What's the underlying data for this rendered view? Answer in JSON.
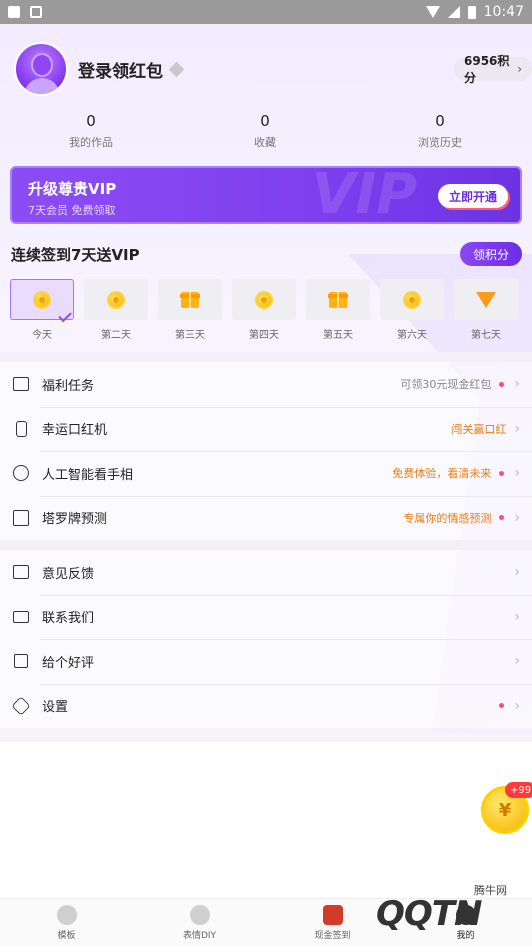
{
  "status_bar": {
    "time": "10:47"
  },
  "profile": {
    "login_text": "登录领红包",
    "points": "6956积分",
    "chevron": "›"
  },
  "stats": [
    {
      "value": "0",
      "label": "我的作品"
    },
    {
      "value": "0",
      "label": "收藏"
    },
    {
      "value": "0",
      "label": "浏览历史"
    }
  ],
  "vip": {
    "title": "升级尊贵VIP",
    "subtitle": "7天会员 免费领取",
    "button": "立即开通",
    "deco": "VIP"
  },
  "signin": {
    "title": "连续签到7天送VIP",
    "claim_button": "领积分",
    "days": [
      {
        "label": "今天",
        "icon": "coin-icon"
      },
      {
        "label": "第二天",
        "icon": "coin-icon"
      },
      {
        "label": "第三天",
        "icon": "gift-icon"
      },
      {
        "label": "第四天",
        "icon": "coin-icon"
      },
      {
        "label": "第五天",
        "icon": "gift-icon"
      },
      {
        "label": "第六天",
        "icon": "coin-icon"
      },
      {
        "label": "第七天",
        "icon": "gem-icon"
      }
    ]
  },
  "menu": {
    "group1": [
      {
        "label": "福利任务",
        "right": "可领30元现金红包",
        "icon": "basket-icon"
      },
      {
        "label": "幸运口红机",
        "right": "闯关赢口红",
        "icon": "lipstick-icon"
      },
      {
        "label": "人工智能看手相",
        "right": "免费体验，看清未来",
        "icon": "ai-head-icon"
      },
      {
        "label": "塔罗牌预测",
        "right": "专属你的情感预测",
        "icon": "tarot-card-icon"
      }
    ],
    "group2": [
      {
        "label": "意见反馈",
        "icon": "inbox-icon"
      },
      {
        "label": "联系我们",
        "icon": "chat-icon"
      },
      {
        "label": "给个好评",
        "icon": "thumbs-up-icon"
      },
      {
        "label": "设置",
        "icon": "settings-icon"
      }
    ]
  },
  "floating": {
    "badge": "+99",
    "symbol": "¥"
  },
  "tabbar": [
    {
      "label": "模板"
    },
    {
      "label": "表情DIY"
    },
    {
      "label": "现金签到"
    },
    {
      "label": "我的"
    }
  ],
  "watermark": {
    "text": "QQTN",
    "small": "腾牛网"
  },
  "colors": {
    "accent": "#7e3fef",
    "orange": "#f07b14",
    "red_dot": "#ff4d6d"
  }
}
